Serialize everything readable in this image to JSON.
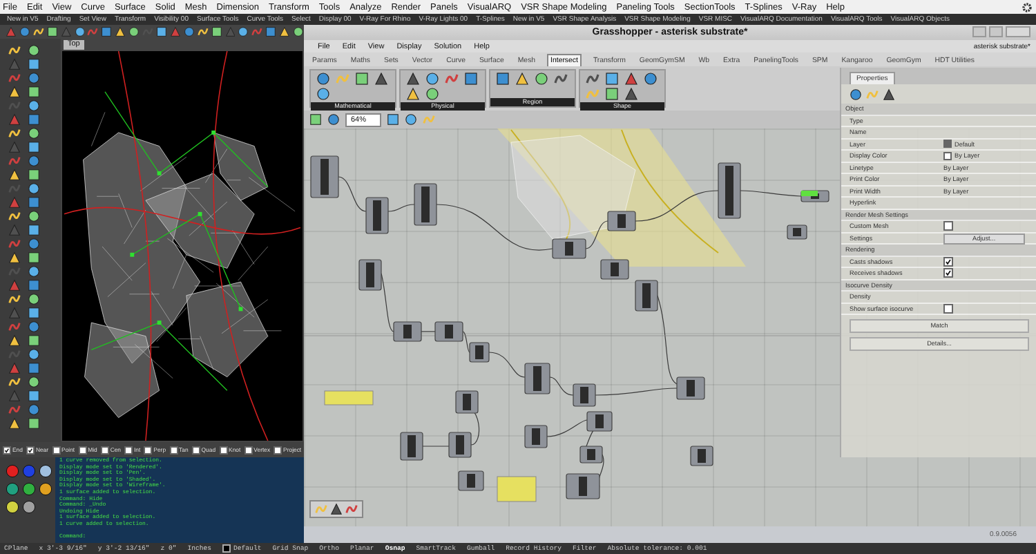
{
  "rhino_menu": [
    "File",
    "Edit",
    "View",
    "Curve",
    "Surface",
    "Solid",
    "Mesh",
    "Dimension",
    "Transform",
    "Tools",
    "Analyze",
    "Render",
    "Panels",
    "VisualARQ",
    "VSR Shape Modeling",
    "Paneling Tools",
    "SectionTools",
    "T-Splines",
    "V-Ray",
    "Help"
  ],
  "toolbar_tabs": [
    "New in V5",
    "Drafting",
    "Set View",
    "Transform",
    "Visibility 00",
    "Surface Tools",
    "Curve Tools",
    "Select",
    "Display 00",
    "V-Ray For Rhino",
    "V-Ray Lights 00",
    "T-Splines",
    "New in V5",
    "VSR Shape Analysis",
    "VSR Shape Modeling",
    "VSR MISC",
    "VisualARQ Documentation",
    "VisualARQ Tools",
    "VisualARQ Objects"
  ],
  "viewport": {
    "title": "Top"
  },
  "osnaps": [
    {
      "label": "End",
      "checked": true
    },
    {
      "label": "Near",
      "checked": true
    },
    {
      "label": "Point",
      "checked": false
    },
    {
      "label": "Mid",
      "checked": false
    },
    {
      "label": "Cen",
      "checked": false
    },
    {
      "label": "Int",
      "checked": false
    },
    {
      "label": "Perp",
      "checked": false
    },
    {
      "label": "Tan",
      "checked": false
    },
    {
      "label": "Quad",
      "checked": false
    },
    {
      "label": "Knot",
      "checked": false
    },
    {
      "label": "Vertex",
      "checked": false
    },
    {
      "label": "Project",
      "checked": false
    }
  ],
  "command_history": [
    "1 curve removed from selection.",
    "Display mode set to 'Rendered'.",
    "Display mode set to 'Pen'.",
    "Display mode set to 'Shaded'.",
    "Display mode set to 'Wireframe'.",
    "1 surface added to selection.",
    "Command: Hide",
    "Command: _Undo",
    "Undoing Hide",
    "1 surface added to selection.",
    "1 curve added to selection."
  ],
  "command_prompt": "Command:",
  "grasshopper": {
    "title": "Grasshopper - asterisk substrate*",
    "menu": [
      "File",
      "Edit",
      "View",
      "Display",
      "Solution",
      "Help"
    ],
    "document": "asterisk substrate*",
    "tabs": [
      {
        "label": "Params",
        "selected": false
      },
      {
        "label": "Maths",
        "selected": false
      },
      {
        "label": "Sets",
        "selected": false
      },
      {
        "label": "Vector",
        "selected": false
      },
      {
        "label": "Curve",
        "selected": false
      },
      {
        "label": "Surface",
        "selected": false
      },
      {
        "label": "Mesh",
        "selected": false
      },
      {
        "label": "Intersect",
        "selected": true
      },
      {
        "label": "Transform",
        "selected": false
      },
      {
        "label": "GeomGymSM",
        "selected": false
      },
      {
        "label": "Wb",
        "selected": false
      },
      {
        "label": "Extra",
        "selected": false
      },
      {
        "label": "PanelingTools",
        "selected": false
      },
      {
        "label": "SPM",
        "selected": false
      },
      {
        "label": "Kangaroo",
        "selected": false
      },
      {
        "label": "GeomGym",
        "selected": false
      },
      {
        "label": "HDT Utilities",
        "selected": false
      }
    ],
    "panels": [
      "Mathematical",
      "Physical",
      "Region",
      "Shape"
    ],
    "zoom": "64%",
    "version": "0.9.0056"
  },
  "properties": {
    "tab": "Properties",
    "rows": [
      {
        "kind": "section",
        "label": "Object"
      },
      {
        "kind": "field",
        "label": "Type"
      },
      {
        "kind": "field",
        "label": "Name"
      },
      {
        "kind": "swatch",
        "label": "Layer",
        "value": "Default"
      },
      {
        "kind": "swatch",
        "label": "Display Color",
        "value": "By Layer"
      },
      {
        "kind": "field",
        "label": "Linetype",
        "value": "By Layer"
      },
      {
        "kind": "field",
        "label": "Print Color",
        "value": "By Layer"
      },
      {
        "kind": "field",
        "label": "Print Width",
        "value": "By Layer"
      },
      {
        "kind": "field",
        "label": "Hyperlink"
      },
      {
        "kind": "section",
        "label": "Render Mesh Settings"
      },
      {
        "kind": "check",
        "label": "Custom Mesh",
        "checked": false
      },
      {
        "kind": "button",
        "label": "Settings",
        "value": "Adjust..."
      },
      {
        "kind": "section",
        "label": "Rendering"
      },
      {
        "kind": "check",
        "label": "Casts shadows",
        "checked": true
      },
      {
        "kind": "check",
        "label": "Receives shadows",
        "checked": true
      },
      {
        "kind": "section",
        "label": "Isocurve Density"
      },
      {
        "kind": "field",
        "label": "Density"
      },
      {
        "kind": "check",
        "label": "Show surface isocurve",
        "checked": false
      }
    ],
    "buttons": [
      "Match",
      "Details..."
    ]
  },
  "status_bar": {
    "cplane": "CPlane",
    "x": "x 3'-3 9/16\"",
    "y": "y 3'-2 13/16\"",
    "z": "z 0\"",
    "units": "Inches",
    "layer": "Default",
    "toggles": [
      {
        "label": "Grid Snap",
        "on": false
      },
      {
        "label": "Ortho",
        "on": false
      },
      {
        "label": "Planar",
        "on": false
      },
      {
        "label": "Osnap",
        "on": true
      },
      {
        "label": "SmartTrack",
        "on": false
      },
      {
        "label": "Gumball",
        "on": false
      },
      {
        "label": "Record History",
        "on": false
      },
      {
        "label": "Filter",
        "on": false
      }
    ],
    "tolerance": "Absolute tolerance: 0.001"
  }
}
